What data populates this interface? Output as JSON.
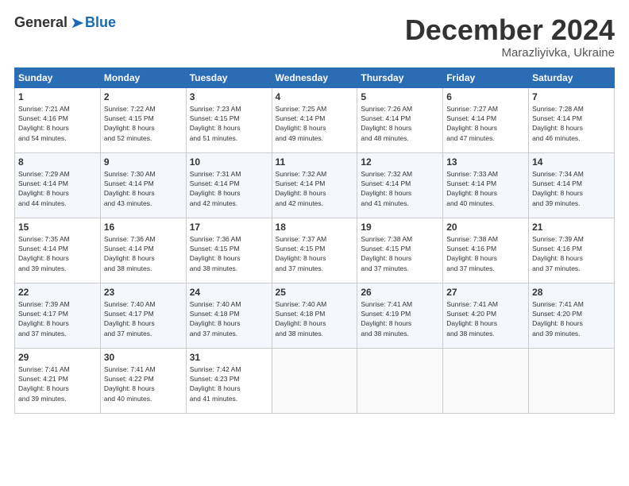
{
  "header": {
    "logo_general": "General",
    "logo_blue": "Blue",
    "month": "December 2024",
    "location": "Marazliyivka, Ukraine"
  },
  "days_of_week": [
    "Sunday",
    "Monday",
    "Tuesday",
    "Wednesday",
    "Thursday",
    "Friday",
    "Saturday"
  ],
  "weeks": [
    [
      {
        "day": "1",
        "info": "Sunrise: 7:21 AM\nSunset: 4:16 PM\nDaylight: 8 hours\nand 54 minutes."
      },
      {
        "day": "2",
        "info": "Sunrise: 7:22 AM\nSunset: 4:15 PM\nDaylight: 8 hours\nand 52 minutes."
      },
      {
        "day": "3",
        "info": "Sunrise: 7:23 AM\nSunset: 4:15 PM\nDaylight: 8 hours\nand 51 minutes."
      },
      {
        "day": "4",
        "info": "Sunrise: 7:25 AM\nSunset: 4:14 PM\nDaylight: 8 hours\nand 49 minutes."
      },
      {
        "day": "5",
        "info": "Sunrise: 7:26 AM\nSunset: 4:14 PM\nDaylight: 8 hours\nand 48 minutes."
      },
      {
        "day": "6",
        "info": "Sunrise: 7:27 AM\nSunset: 4:14 PM\nDaylight: 8 hours\nand 47 minutes."
      },
      {
        "day": "7",
        "info": "Sunrise: 7:28 AM\nSunset: 4:14 PM\nDaylight: 8 hours\nand 46 minutes."
      }
    ],
    [
      {
        "day": "8",
        "info": "Sunrise: 7:29 AM\nSunset: 4:14 PM\nDaylight: 8 hours\nand 44 minutes."
      },
      {
        "day": "9",
        "info": "Sunrise: 7:30 AM\nSunset: 4:14 PM\nDaylight: 8 hours\nand 43 minutes."
      },
      {
        "day": "10",
        "info": "Sunrise: 7:31 AM\nSunset: 4:14 PM\nDaylight: 8 hours\nand 42 minutes."
      },
      {
        "day": "11",
        "info": "Sunrise: 7:32 AM\nSunset: 4:14 PM\nDaylight: 8 hours\nand 42 minutes."
      },
      {
        "day": "12",
        "info": "Sunrise: 7:32 AM\nSunset: 4:14 PM\nDaylight: 8 hours\nand 41 minutes."
      },
      {
        "day": "13",
        "info": "Sunrise: 7:33 AM\nSunset: 4:14 PM\nDaylight: 8 hours\nand 40 minutes."
      },
      {
        "day": "14",
        "info": "Sunrise: 7:34 AM\nSunset: 4:14 PM\nDaylight: 8 hours\nand 39 minutes."
      }
    ],
    [
      {
        "day": "15",
        "info": "Sunrise: 7:35 AM\nSunset: 4:14 PM\nDaylight: 8 hours\nand 39 minutes."
      },
      {
        "day": "16",
        "info": "Sunrise: 7:36 AM\nSunset: 4:14 PM\nDaylight: 8 hours\nand 38 minutes."
      },
      {
        "day": "17",
        "info": "Sunrise: 7:36 AM\nSunset: 4:15 PM\nDaylight: 8 hours\nand 38 minutes."
      },
      {
        "day": "18",
        "info": "Sunrise: 7:37 AM\nSunset: 4:15 PM\nDaylight: 8 hours\nand 37 minutes."
      },
      {
        "day": "19",
        "info": "Sunrise: 7:38 AM\nSunset: 4:15 PM\nDaylight: 8 hours\nand 37 minutes."
      },
      {
        "day": "20",
        "info": "Sunrise: 7:38 AM\nSunset: 4:16 PM\nDaylight: 8 hours\nand 37 minutes."
      },
      {
        "day": "21",
        "info": "Sunrise: 7:39 AM\nSunset: 4:16 PM\nDaylight: 8 hours\nand 37 minutes."
      }
    ],
    [
      {
        "day": "22",
        "info": "Sunrise: 7:39 AM\nSunset: 4:17 PM\nDaylight: 8 hours\nand 37 minutes."
      },
      {
        "day": "23",
        "info": "Sunrise: 7:40 AM\nSunset: 4:17 PM\nDaylight: 8 hours\nand 37 minutes."
      },
      {
        "day": "24",
        "info": "Sunrise: 7:40 AM\nSunset: 4:18 PM\nDaylight: 8 hours\nand 37 minutes."
      },
      {
        "day": "25",
        "info": "Sunrise: 7:40 AM\nSunset: 4:18 PM\nDaylight: 8 hours\nand 38 minutes."
      },
      {
        "day": "26",
        "info": "Sunrise: 7:41 AM\nSunset: 4:19 PM\nDaylight: 8 hours\nand 38 minutes."
      },
      {
        "day": "27",
        "info": "Sunrise: 7:41 AM\nSunset: 4:20 PM\nDaylight: 8 hours\nand 38 minutes."
      },
      {
        "day": "28",
        "info": "Sunrise: 7:41 AM\nSunset: 4:20 PM\nDaylight: 8 hours\nand 39 minutes."
      }
    ],
    [
      {
        "day": "29",
        "info": "Sunrise: 7:41 AM\nSunset: 4:21 PM\nDaylight: 8 hours\nand 39 minutes."
      },
      {
        "day": "30",
        "info": "Sunrise: 7:41 AM\nSunset: 4:22 PM\nDaylight: 8 hours\nand 40 minutes."
      },
      {
        "day": "31",
        "info": "Sunrise: 7:42 AM\nSunset: 4:23 PM\nDaylight: 8 hours\nand 41 minutes."
      },
      {
        "day": "",
        "info": ""
      },
      {
        "day": "",
        "info": ""
      },
      {
        "day": "",
        "info": ""
      },
      {
        "day": "",
        "info": ""
      }
    ]
  ]
}
